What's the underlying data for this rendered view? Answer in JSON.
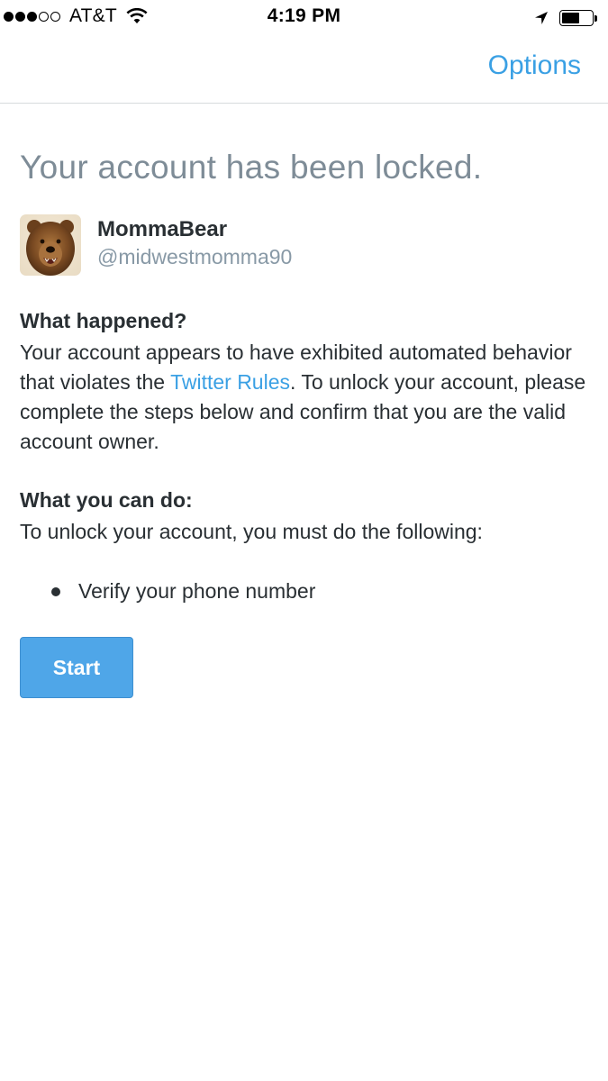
{
  "status_bar": {
    "carrier": "AT&T",
    "signal_bars_filled": 3,
    "signal_bars_total": 5,
    "time": "4:19 PM",
    "icons": [
      "wifi-icon",
      "location-arrow-icon",
      "battery-icon"
    ],
    "battery_level": 0.6
  },
  "nav": {
    "options_label": "Options"
  },
  "page": {
    "title": "Your account has been locked."
  },
  "profile": {
    "display_name": "MommaBear",
    "handle": "@midwestmomma90",
    "avatar_icon": "bear-avatar"
  },
  "what_happened": {
    "heading": "What happened?",
    "text_before_link": "Your account appears to have exhibited automated behavior that violates the ",
    "link_text": "Twitter Rules",
    "text_after_link": ". To unlock your account, please complete the steps below and confirm that you are the valid account owner."
  },
  "what_you_can_do": {
    "heading": "What you can do:",
    "intro": "To unlock your account, you must do the following:",
    "steps": [
      "Verify your phone number"
    ]
  },
  "actions": {
    "start_label": "Start"
  },
  "colors": {
    "accent": "#3aa0e4",
    "button": "#4fa6e8",
    "title_gray": "#7e8c97",
    "text": "#292f33"
  }
}
